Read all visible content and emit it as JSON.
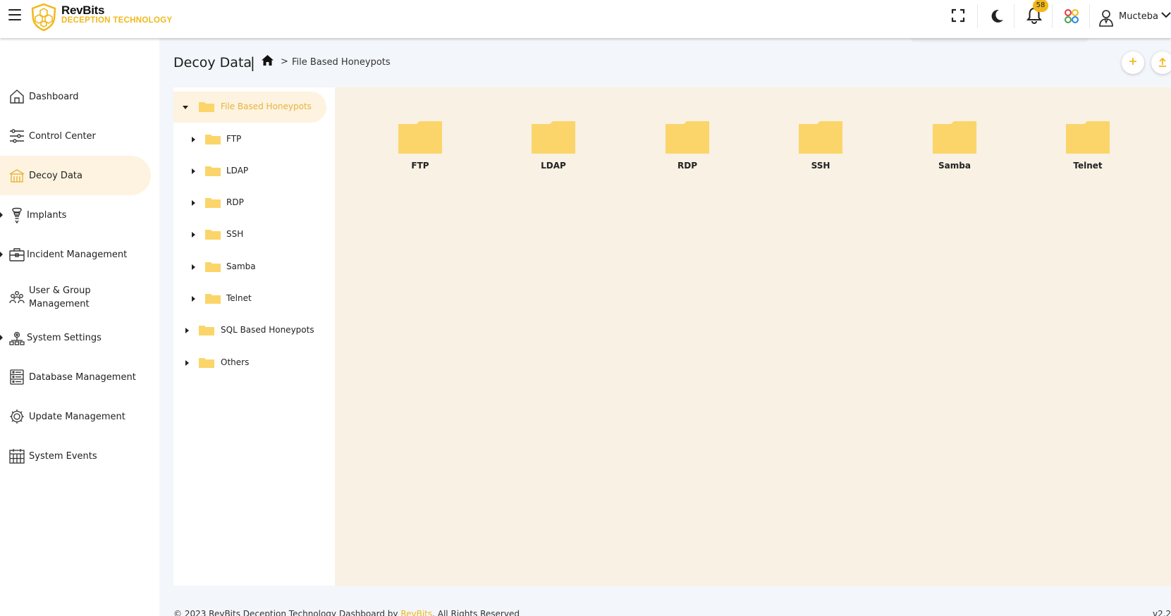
{
  "brand": {
    "name": "RevBits",
    "tagline": "DECEPTION TECHNOLOGY"
  },
  "header": {
    "notification_count": "58",
    "user_name": "Mucteba"
  },
  "sidebar": {
    "items": [
      {
        "label": "Dashboard",
        "icon": "home-icon"
      },
      {
        "label": "Control Center",
        "icon": "sliders-icon"
      },
      {
        "label": "Decoy Data",
        "icon": "decoy-data-icon"
      },
      {
        "label": "Implants",
        "icon": "implant-icon"
      },
      {
        "label": "Incident Management",
        "icon": "toolbox-icon"
      },
      {
        "label": "User & Group Management",
        "icon": "users-icon"
      },
      {
        "label": "System Settings",
        "icon": "network-settings-icon"
      },
      {
        "label": "Database Management",
        "icon": "database-icon"
      },
      {
        "label": "Update Management",
        "icon": "cog-icon"
      },
      {
        "label": "System Events",
        "icon": "calendar-icon"
      }
    ]
  },
  "page": {
    "title": "Decoy Data",
    "separator": "|",
    "breadcrumb_chevron": ">",
    "breadcrumb_current": "File Based Honeypots"
  },
  "tree": {
    "root": "File Based Honeypots",
    "children": [
      "FTP",
      "LDAP",
      "RDP",
      "SSH",
      "Samba",
      "Telnet"
    ],
    "others": [
      "SQL Based Honeypots",
      "Others"
    ]
  },
  "grid": {
    "folders": [
      "FTP",
      "LDAP",
      "RDP",
      "SSH",
      "Samba",
      "Telnet"
    ]
  },
  "footer": {
    "text_prefix": "© 2023 RevBits Deception Technology Dashboard by",
    "brand_link": "RevBits",
    "text_suffix": ". All Rights Reserved",
    "version": "v2.2"
  },
  "colors": {
    "accent": "#f1b81b",
    "folder": "#fbd56a",
    "active_bg": "#fdf3e0",
    "grid_bg": "#f8f1e4"
  }
}
